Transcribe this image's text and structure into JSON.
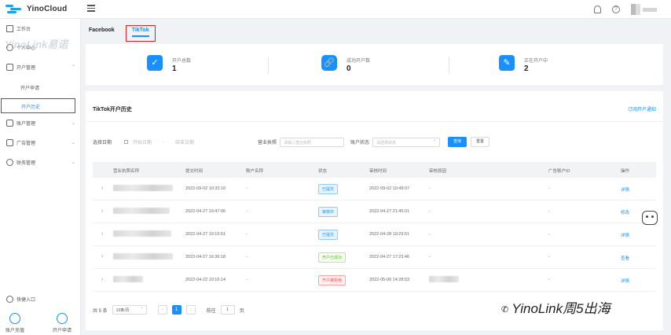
{
  "app": {
    "logo_text": "YinoCloud",
    "watermark": "YinoLink易诺"
  },
  "sidebar": {
    "items": [
      {
        "label": "工作台"
      },
      {
        "label": "个人中心"
      },
      {
        "label": "开户管理"
      },
      {
        "label": "账户管理"
      },
      {
        "label": "广告管理"
      },
      {
        "label": "财务管理"
      }
    ],
    "sub_items": [
      {
        "label": "开户申请"
      },
      {
        "label": "开户历史"
      }
    ],
    "quick_entry": "快捷入口",
    "bottom_buttons": [
      {
        "label": "账户充值"
      },
      {
        "label": "开户申请"
      }
    ]
  },
  "tabs": [
    {
      "label": "Facebook"
    },
    {
      "label": "TikTok"
    }
  ],
  "stats": [
    {
      "label": "开户总数",
      "value": "1",
      "icon": "✓"
    },
    {
      "label": "成功开户数",
      "value": "0",
      "icon": "🔗"
    },
    {
      "label": "正在开户中",
      "value": "2",
      "icon": "✎"
    }
  ],
  "panel": {
    "title": "TikTok开户历史",
    "link": "订阅开户通知"
  },
  "filters": {
    "date_label": "选择日期",
    "start_placeholder": "开始日期",
    "sep": "-",
    "end_placeholder": "结束日期",
    "company_label": "营业执照",
    "company_placeholder": "请输入营业执照",
    "status_label": "账户状态",
    "status_placeholder": "请选择状态",
    "search": "查询",
    "reset": "重置"
  },
  "table": {
    "headers": [
      "营业执照名称",
      "提交时间",
      "账户名称",
      "状态",
      "审核时间",
      "审核原因",
      "广告账户ID",
      "操作"
    ],
    "rows": [
      {
        "submit_time": "2022-09-02 10:33:10",
        "account": "-",
        "status": "已提交",
        "review_time": "2022-09-02 10:49:07",
        "reason": "-",
        "ad_id": "-",
        "action": "详情"
      },
      {
        "submit_time": "2022-04-27 19:47:06",
        "account": "-",
        "status": "审核中",
        "review_time": "2022-04-27 21:45:01",
        "reason": "-",
        "ad_id": "-",
        "action": "修改"
      },
      {
        "submit_time": "2022-04-27 19:16:51",
        "account": "-",
        "status": "已提交",
        "review_time": "2022-04-28 19:29:51",
        "reason": "-",
        "ad_id": "-",
        "action": "详情"
      },
      {
        "submit_time": "2022-04-27 16:36:18",
        "account": "-",
        "status": "开户已成功",
        "review_time": "2022-04-27 17:23:46",
        "reason": "-",
        "ad_id": "-",
        "action": "查看"
      },
      {
        "submit_time": "2022-04-22 10:16:14",
        "account": "-",
        "status": "开户被拒绝",
        "review_time": "2022-05-06 14:28:53",
        "reason": "",
        "ad_id": "-",
        "action": "详情"
      }
    ]
  },
  "pager": {
    "total": "共 5 条",
    "page_size": "10条/页",
    "current": "1",
    "goto_label": "前往",
    "goto_value": "1",
    "page_suffix": "页"
  },
  "footer_watermark": "YinoLink周5出海"
}
